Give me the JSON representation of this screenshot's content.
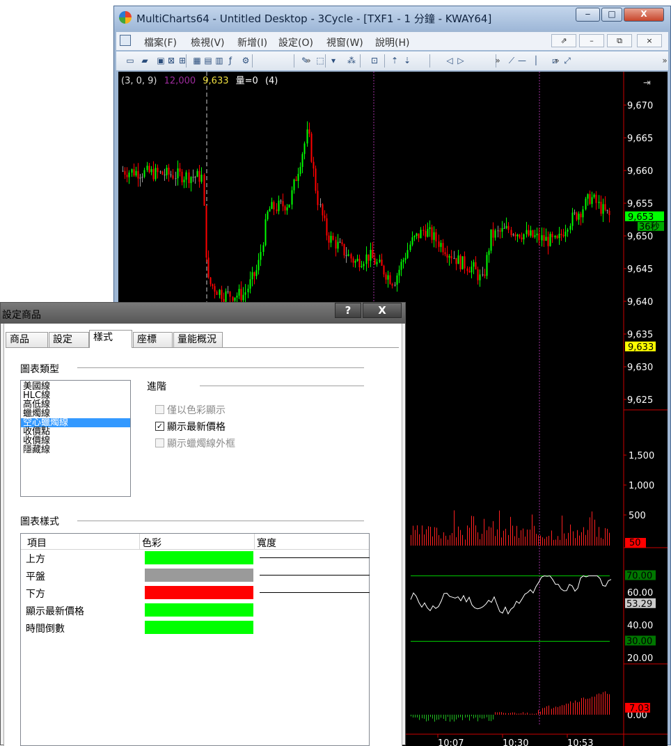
{
  "window": {
    "title": "MultiCharts64 - Untitled Desktop - 3Cycle - [TXF1 - 1 分鐘 - KWAY64]",
    "menu": [
      "檔案(F)",
      "檢視(V)",
      "新增(I)",
      "設定(O)",
      "視窗(W)",
      "說明(H)"
    ],
    "mdi_buttons": [
      "⇗",
      "–",
      "⧉",
      "×"
    ],
    "caption_buttons": [
      "‒",
      "□",
      "X"
    ]
  },
  "toolbar": {
    "overflow_glyph": "»",
    "icons": [
      "new-workspace-icon",
      "open-folder-icon",
      "save-icon",
      "close-workspace-icon",
      "chart-window-icon",
      "scanner-icon",
      "dom-icon",
      "portfolio-icon",
      "insert-study-icon",
      "format-study-icon",
      "insert-drawing-icon",
      "cursor-icon",
      "dropdown-icon",
      "tick-icon",
      "tool-icon",
      "bar-up-icon",
      "bar-down-icon",
      "play-back-icon",
      "play-forward-icon",
      "line-tool-icon",
      "horizontal-line-icon",
      "vertical-line-icon",
      "channel-tool-icon",
      "ray-tool-icon"
    ]
  },
  "chart": {
    "status": {
      "params": "(3,  0,  9)",
      "value1": "12,000",
      "value2": "9,633",
      "volume": "量=0",
      "count": "(4)"
    },
    "colors": {
      "up": "#00ff00",
      "flat": "#9a9a9a",
      "down": "#ff0000",
      "last_price": "#00ff00",
      "volume": "#ff2020",
      "osc": "#ffffff",
      "band": "#00cc00"
    },
    "price_axis": {
      "labels": [
        "9,670",
        "9,665",
        "9,660",
        "9,655",
        "9,650",
        "9,645",
        "9,640",
        "9,635",
        "9,630",
        "9,625"
      ],
      "last_price_tag": "9,653",
      "countdown_tag": "36秒",
      "marker_tag": "9,633",
      "corner_icon": "⇥"
    },
    "volume_axis": {
      "labels": [
        "1,500",
        "1,000",
        "500"
      ],
      "last_tag": "50"
    },
    "osc_axis": {
      "labels": [
        "60.00",
        "40.00",
        "20.00"
      ],
      "upper_tag": "70.00",
      "last_tag": "53.29",
      "lower_tag": "30.00"
    },
    "macd_axis": {
      "labels": [
        "0.00"
      ],
      "last_tag": "7.03"
    },
    "time_axis": [
      "10:07",
      "10:30",
      "10:53"
    ]
  },
  "chart_data": {
    "type": "candlestick",
    "instrument": "TXF1",
    "interval": "1 分鐘",
    "price_range": [
      9621,
      9671
    ],
    "panes": [
      {
        "type": "candlestick",
        "name": "price",
        "ylim": [
          9621,
          9671
        ],
        "ticks": [
          9670,
          9665,
          9660,
          9655,
          9650,
          9645,
          9640,
          9635,
          9630,
          9625
        ],
        "last": 9653
      },
      {
        "type": "bar",
        "name": "volume",
        "ticks": [
          1500,
          1000,
          500
        ],
        "last": 50
      },
      {
        "type": "line",
        "name": "oscillator",
        "ylim": [
          10,
          80
        ],
        "ticks": [
          60,
          40,
          20
        ],
        "upper": 70,
        "lower": 30,
        "last": 53.29
      },
      {
        "type": "bar",
        "name": "histogram",
        "ticks": [
          0
        ],
        "last": 7.03
      }
    ],
    "x_ticks": [
      "10:07",
      "10:30",
      "10:53"
    ]
  },
  "dialog": {
    "title": "設定商品",
    "buttons": [
      "?",
      "X"
    ],
    "tabs": [
      "商品",
      "設定",
      "樣式",
      "座標",
      "量能概況"
    ],
    "active_tab": "樣式",
    "chart_type": {
      "label": "圖表類型",
      "items": [
        "美國線",
        "HLC線",
        "高低線",
        "蠟燭線",
        "空心蠟燭線",
        "收價點",
        "收價線",
        "隱藏線"
      ],
      "selected": "空心蠟燭線"
    },
    "advanced": {
      "label": "進階",
      "options": [
        {
          "label": "僅以色彩顯示",
          "checked": false,
          "enabled": false
        },
        {
          "label": "顯示最新價格",
          "checked": true,
          "enabled": true
        },
        {
          "label": "顯示蠟燭線外框",
          "checked": false,
          "enabled": false
        }
      ]
    },
    "chart_style": {
      "label": "圖表樣式",
      "headers": [
        "項目",
        "色彩",
        "寬度"
      ],
      "rows": [
        {
          "label": "上方",
          "color": "#00ff00",
          "has_width": true
        },
        {
          "label": "平盤",
          "color": "#9a9a9a",
          "has_width": true
        },
        {
          "label": "下方",
          "color": "#ff0000",
          "has_width": true
        },
        {
          "label": "顯示最新價格",
          "color": "#00ff00",
          "has_width": false
        },
        {
          "label": "時間倒數",
          "color": "#00ff00",
          "has_width": false
        }
      ]
    }
  }
}
